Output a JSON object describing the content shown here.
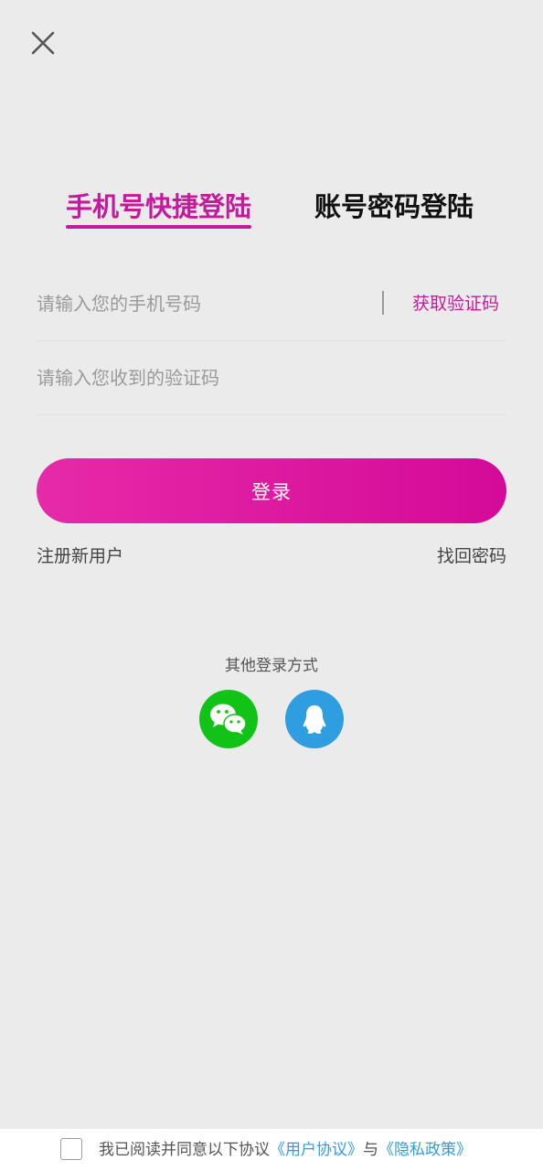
{
  "tabs": {
    "phone_login": "手机号快捷登陆",
    "account_login": "账号密码登陆"
  },
  "form": {
    "phone_placeholder": "请输入您的手机号码",
    "get_code_label": "获取验证码",
    "code_placeholder": "请输入您收到的验证码",
    "login_label": "登录"
  },
  "links": {
    "register": "注册新用户",
    "forgot_password": "找回密码"
  },
  "other_login": {
    "title": "其他登录方式",
    "wechat_icon": "wechat-icon",
    "qq_icon": "qq-icon"
  },
  "footer": {
    "agree_text": "我已阅读并同意以下协议",
    "user_agreement": "《用户协议》",
    "and": "与",
    "privacy_policy": "《隐私政策》"
  },
  "colors": {
    "accent": "#c41a9e",
    "link": "#2e9ee0",
    "wechat": "#12c317",
    "qq": "#2e9ee0",
    "background": "#ebebeb"
  }
}
